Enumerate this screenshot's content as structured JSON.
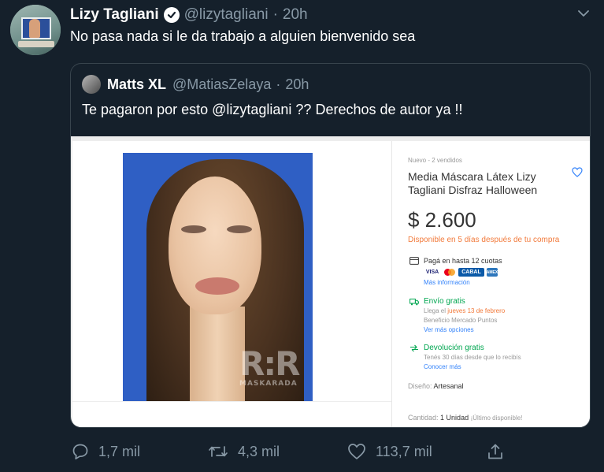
{
  "tweet": {
    "author_name": "Lizy Tagliani",
    "author_handle": "@lizytagliani",
    "separator": "·",
    "time": "20h",
    "text": "No pasa nada si le da trabajo a alguien bienvenido sea"
  },
  "quoted_tweet": {
    "author_name": "Matts XL",
    "author_handle": "@MatiasZelaya",
    "separator": "·",
    "time": "20h",
    "text": "Te pagaron por esto @lizytagliani ?? Derechos de autor ya !!"
  },
  "listing": {
    "condition_sold": "Nuevo  -  2 vendidos",
    "title": "Media Máscara Látex Lizy Tagliani Disfraz Halloween",
    "price": "$ 2.600",
    "availability": "Disponible en 5 días después de tu compra",
    "payment": {
      "label": "Pagá en hasta 12 cuotas",
      "cards": [
        "VISA",
        "CABAL",
        "AMEX"
      ],
      "more_info": "Más información"
    },
    "shipping": {
      "label": "Envío gratis",
      "arrival_prefix": "Llega el ",
      "arrival_date": "jueves 13 de febrero",
      "points": "Beneficio Mercado Puntos",
      "options": "Ver más opciones"
    },
    "returns": {
      "label": "Devolución gratis",
      "detail": "Tenés 30 días desde que lo recibís",
      "more": "Conocer más"
    },
    "design_label": "Diseño:",
    "design_value": "Artesanal",
    "quantity_label": "Cantidad:",
    "quantity_value": "1 Unidad",
    "quantity_note": "¡Último disponible!",
    "watermark_big": "R:R",
    "watermark_small": "MASKARADA"
  },
  "actions": {
    "replies": "1,7 mil",
    "retweets": "4,3 mil",
    "likes": "113,7 mil"
  },
  "colors": {
    "background": "#15202b",
    "secondary_text": "#8899a6",
    "border": "#38444d",
    "price_orange": "#f27a3b",
    "green": "#00a650",
    "link_blue": "#3483fa"
  },
  "icons": [
    "verified-badge-icon",
    "chevron-down-icon",
    "heart-outline-icon",
    "card-icon",
    "truck-icon",
    "return-icon",
    "reply-icon",
    "retweet-icon",
    "like-icon",
    "share-icon"
  ]
}
